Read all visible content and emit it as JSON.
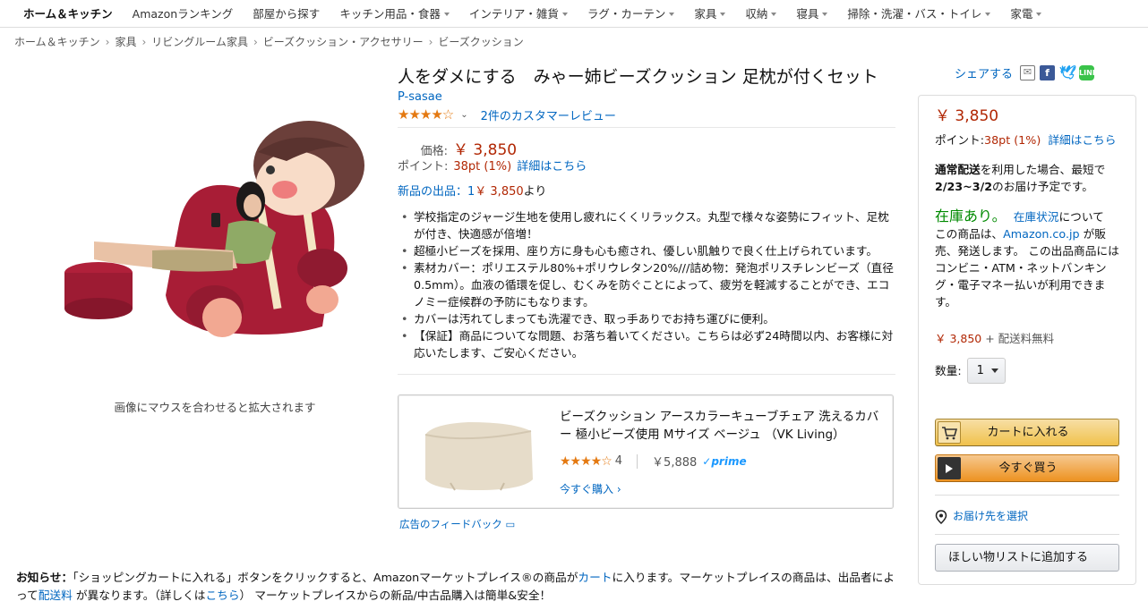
{
  "nav": {
    "items": [
      {
        "label": "ホーム＆キッチン",
        "bold": true,
        "caret": false
      },
      {
        "label": "Amazonランキング",
        "caret": false
      },
      {
        "label": "部屋から探す",
        "caret": false
      },
      {
        "label": "キッチン用品・食器",
        "caret": true
      },
      {
        "label": "インテリア・雑貨",
        "caret": true
      },
      {
        "label": "ラグ・カーテン",
        "caret": true
      },
      {
        "label": "家具",
        "caret": true
      },
      {
        "label": "収納",
        "caret": true
      },
      {
        "label": "寝具",
        "caret": true
      },
      {
        "label": "掃除・洗濯・バス・トイレ",
        "caret": true
      },
      {
        "label": "家電",
        "caret": true
      }
    ]
  },
  "breadcrumb": [
    "ホーム＆キッチン",
    "家具",
    "リビングルーム家具",
    "ビーズクッション・アクセサリー",
    "ビーズクッション"
  ],
  "breadcrumb_sep": "›",
  "image": {
    "zoom_hint": "画像にマウスを合わせると拡大されます"
  },
  "product": {
    "title": "人をダメにする　みゃー姉ビーズクッション 足枕が付くセット",
    "brand": "P-sasae",
    "rating_stars": 4.5,
    "reviews_link": "2件のカスタマーレビュー",
    "price_label": "価格:",
    "price": "￥ 3,850",
    "points_label": "ポイント:",
    "points": "38pt  (1%)",
    "points_detail": "詳細はこちら",
    "new_offers_link": "新品の出品：1",
    "new_offers_price": "￥ 3,850",
    "new_offers_suffix": "より",
    "bullets": [
      "学校指定のジャージ生地を使用し疲れにくくリラックス。丸型で様々な姿勢にフィット、足枕が付き、快適感が倍増！",
      "超極小ビーズを採用、座り方に身も心も癒され、優しい肌触りで良く仕上げられています。",
      "素材カバー：ポリエステル80%+ポリウレタン20%///詰め物：発泡ポリスチレンビーズ（直径0.5mm）。血液の循環を促し、むくみを防ぐことによって、疲労を軽減することができ、エコノミー症候群の予防にもなります。",
      "カバーは汚れてしまっても洗濯でき、取っ手ありでお持ち運びに便利。",
      "【保証】商品についてな問題、お落ち着いてください。こちらは必ず24時間以内、お客様に対応いたします、ご安心ください。"
    ]
  },
  "ad": {
    "title": "ビーズクッション アースカラーキューブチェア 洗えるカバー 極小ビーズ使用 Mサイズ ベージュ （VK Living）",
    "rating_stars": 4,
    "review_count": "4",
    "price": "￥5,888",
    "prime": "✓prime",
    "buy_link": "今すぐ購入 ›",
    "feedback": "広告のフィードバック"
  },
  "notice": {
    "label": "お知らせ：",
    "text1": "「ショッピングカートに入れる」ボタンをクリックすると、Amazonマーケットプレイス®の商品が",
    "cart_link": "カート",
    "text2": "に入ります。マーケットプレイスの商品は、出品者によって",
    "shipping_link": "配送料",
    "text3": " が異なります。（詳しくは",
    "here_link": "こちら",
    "text4": "） マーケットプレイスからの新品/中古品購入は簡単&安全！"
  },
  "share": {
    "label": "シェアする"
  },
  "buybox": {
    "price": "￥ 3,850",
    "points_label": "ポイント:",
    "points": "38pt  (1%)",
    "points_detail": "詳細はこちら",
    "delivery_bold": "通常配送",
    "delivery_text": "を利用した場合、最短で",
    "delivery_date": "2/23~3/2",
    "delivery_suffix": "のお届け予定です。",
    "in_stock": "在庫あり。",
    "stock_status_link": "在庫状況",
    "stock_status_suffix": "について",
    "seller_text1": "この商品は、",
    "seller_link": "Amazon.co.jp",
    "seller_text2": " が販売、発送します。 この出品商品にはコンビニ・ATM・ネットバンキング・電子マネー払いが利用できます。",
    "total_price": "￥ 3,850",
    "total_suffix": " + 配送料無料",
    "qty_label": "数量:",
    "qty_value": "1",
    "add_to_cart": "カートに入れる",
    "buy_now": "今すぐ買う",
    "address_link": "お届け先を選択",
    "wishlist": "ほしい物リストに追加する"
  },
  "colors": {
    "link": "#0066c0",
    "price": "#b12704",
    "instock": "#008a00",
    "star": "#e47911",
    "cart_button": "#f0c14b",
    "buy_button": "#ed9220"
  }
}
